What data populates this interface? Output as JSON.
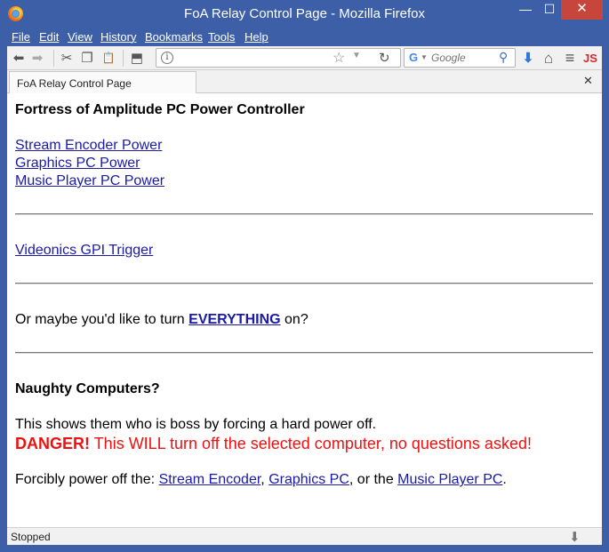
{
  "window": {
    "title": "FoA Relay Control Page - Mozilla Firefox",
    "minimize_glyph": "—",
    "maximize_glyph": "☐",
    "close_glyph": "✕"
  },
  "menu": {
    "file": "File",
    "edit": "Edit",
    "view": "View",
    "history": "History",
    "bookmarks": "Bookmarks",
    "tools": "Tools",
    "help": "Help"
  },
  "toolbar": {
    "back_glyph": "⬅",
    "forward_glyph": "➡",
    "cut_glyph": "✂",
    "copy_glyph": "❐",
    "paste_glyph": "📋",
    "addons_glyph": "⬒",
    "info_glyph": "i",
    "url_value": "",
    "star_glyph": "☆",
    "url_dropdown_glyph": "▼",
    "reload_glyph": "↻",
    "search_engine_glyph": "G",
    "search_dropdown_glyph": "▼",
    "search_placeholder": "Google",
    "search_glyph": "⚲",
    "download_glyph": "⬇",
    "home_glyph": "⌂",
    "menu_glyph": "≡",
    "js_label": "JS"
  },
  "tabs": [
    {
      "label": "FoA Relay Control Page"
    }
  ],
  "tab_close_glyph": "✕",
  "page": {
    "title": "Fortress of Amplitude PC Power Controller",
    "power_links": [
      "Stream Encoder Power",
      "Graphics PC Power",
      "Music Player PC Power"
    ],
    "gpi_link": "Videonics GPI Trigger",
    "everything_prefix": "Or maybe you'd like to turn",
    "everything_link": "EVERYTHING",
    "everything_suffix": "on?",
    "naughty_heading": "Naughty Computers?",
    "boss_text": "This shows them who is boss by forcing a hard power off.",
    "danger_label": "DANGER!",
    "danger_text": "This WILL turn off the selected computer, no questions asked!",
    "force_prefix": "Forcibly power off the:",
    "force_link_1": "Stream Encoder",
    "force_sep_1": ",",
    "force_link_2": "Graphics PC",
    "force_sep_2": ", or the",
    "force_link_3": "Music Player PC",
    "force_end": "."
  },
  "status": {
    "text": "Stopped",
    "download_glyph": "⬇"
  },
  "colors": {
    "titlebar": "#3c5fa8",
    "link": "#1a1aa6",
    "danger": "#ee1111",
    "close_button": "#c7463c"
  }
}
